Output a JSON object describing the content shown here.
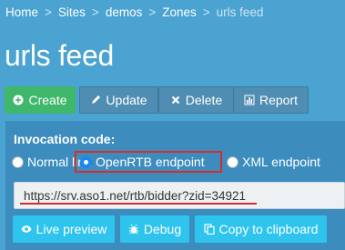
{
  "breadcrumb": {
    "items": [
      "Home",
      "Sites",
      "demos",
      "Zones"
    ],
    "current": "urls feed",
    "separator": ">"
  },
  "page": {
    "title": "urls feed"
  },
  "actions": {
    "create": "Create",
    "update": "Update",
    "delete": "Delete",
    "report": "Report"
  },
  "invocation": {
    "label": "Invocation code:",
    "options": [
      {
        "label": "Normal link",
        "checked": false
      },
      {
        "label": "OpenRTB endpoint",
        "checked": true
      },
      {
        "label": "XML endpoint",
        "checked": false
      }
    ],
    "url": "https://srv.aso1.net/rtb/bidder?zid=34921"
  },
  "tools": {
    "live_preview": "Live preview",
    "debug": "Debug",
    "copy": "Copy to clipboard"
  },
  "colors": {
    "background": "#4aa3d0",
    "panel": "#3c8dbe",
    "create": "#3fb86b",
    "tool_button": "#2ec4ed",
    "highlight": "#d42d2d"
  },
  "icons": {
    "create": "plus-circle-icon",
    "update": "pencil-icon",
    "delete": "x-icon",
    "report": "bar-chart-icon",
    "live_preview": "eye-icon",
    "debug": "bug-icon",
    "copy": "copy-icon"
  }
}
